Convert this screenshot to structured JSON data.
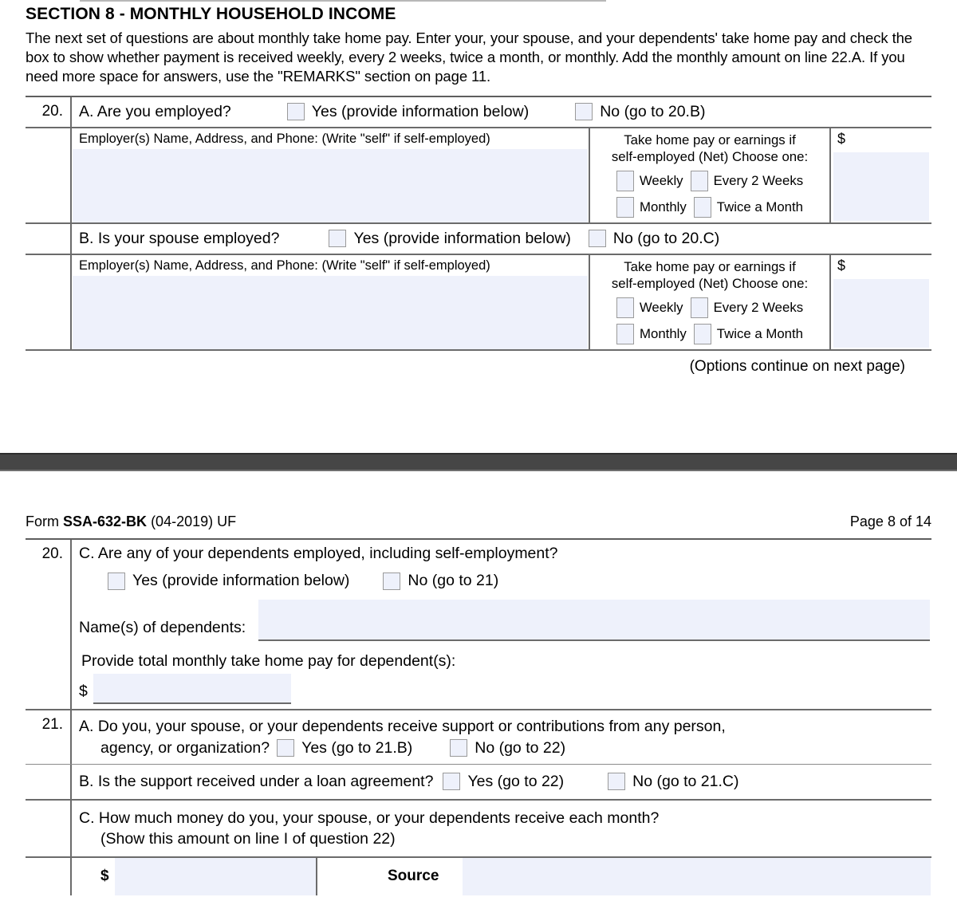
{
  "section": {
    "title": "SECTION 8 - MONTHLY HOUSEHOLD INCOME",
    "intro": "The next set of questions are about monthly take home pay. Enter your, your spouse, and your dependents' take home pay and check the box to show whether payment is received weekly, every 2 weeks, twice a month, or monthly. Add the monthly amount on line 22.A. If you need more space for answers, use the \"REMARKS\" section on page 11."
  },
  "colors": {
    "field_fill": "#eef1fb",
    "checkbox_border": "#9a9a9a",
    "rule": "#6b6b6b",
    "band": "#464646"
  },
  "q20": {
    "number": "20.",
    "a": {
      "question": "A. Are you employed?",
      "yes_label": "Yes (provide information below)",
      "no_label": "No (go to 20.B)",
      "employer_label": "Employer(s) Name, Address, and Phone: (Write \"self\" if self-employed)",
      "takehome_line1": "Take home pay or earnings if",
      "takehome_line2": "self-employed (Net) Choose one:",
      "opt_weekly": "Weekly",
      "opt_every2weeks": "Every 2 Weeks",
      "opt_monthly": "Monthly",
      "opt_twiceamonth": "Twice a Month",
      "dollar_sign": "$"
    },
    "b": {
      "question": "B. Is your spouse employed?",
      "yes_label": "Yes (provide information below)",
      "no_label": "No (go to 20.C)",
      "employer_label": "Employer(s) Name, Address, and Phone: (Write \"self\" if self-employed)",
      "takehome_line1": "Take home pay or earnings if",
      "takehome_line2": "self-employed (Net) Choose one:",
      "opt_weekly": "Weekly",
      "opt_every2weeks": "Every 2 Weeks",
      "opt_monthly": "Monthly",
      "opt_twiceamonth": "Twice a Month",
      "dollar_sign": "$"
    },
    "c": {
      "question": "C. Are any of your dependents employed, including self-employment?",
      "yes_label": "Yes (provide information below)",
      "no_label": "No (go to 21)",
      "names_label": "Name(s) of dependents:",
      "names_value": "",
      "provide_label": "Provide total monthly take home pay for dependent(s):",
      "dollar_sign": "$",
      "dollar_value": ""
    },
    "options_note": "(Options continue on next page)"
  },
  "footer": {
    "form_prefix": "Form",
    "form_id": "SSA-632-BK",
    "form_suffix": "(04-2019) UF",
    "page_label": "Page 8 of 14"
  },
  "q21": {
    "number": "21.",
    "a": {
      "line1": "A. Do you, your spouse, or your dependents receive support or contributions from any person,",
      "line2": "agency, or organization?",
      "yes_label": "Yes (go to 21.B)",
      "no_label": "No (go to 22)"
    },
    "b": {
      "question": "B. Is the support received under a loan agreement?",
      "yes_label": "Yes (go to 22)",
      "no_label": "No (go to 21.C)"
    },
    "c": {
      "line1": "C. How much money do you, your spouse, or your dependents receive each month?",
      "line2": "(Show this amount on line I of question 22)",
      "dollar_sign": "$",
      "dollar_value": "",
      "source_label": "Source",
      "source_value": ""
    }
  }
}
